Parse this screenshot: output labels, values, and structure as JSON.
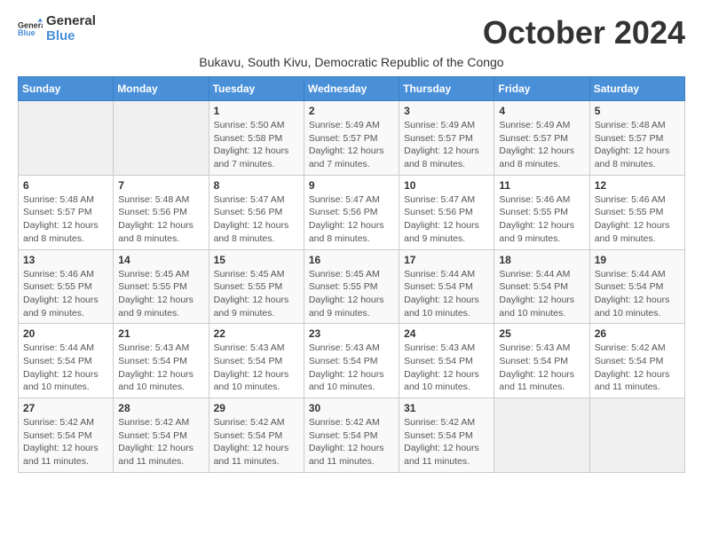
{
  "header": {
    "logo_general": "General",
    "logo_blue": "Blue",
    "month_title": "October 2024",
    "subtitle": "Bukavu, South Kivu, Democratic Republic of the Congo"
  },
  "weekdays": [
    "Sunday",
    "Monday",
    "Tuesday",
    "Wednesday",
    "Thursday",
    "Friday",
    "Saturday"
  ],
  "weeks": [
    [
      {
        "day": "",
        "info": ""
      },
      {
        "day": "",
        "info": ""
      },
      {
        "day": "1",
        "info": "Sunrise: 5:50 AM\nSunset: 5:58 PM\nDaylight: 12 hours and 7 minutes."
      },
      {
        "day": "2",
        "info": "Sunrise: 5:49 AM\nSunset: 5:57 PM\nDaylight: 12 hours and 7 minutes."
      },
      {
        "day": "3",
        "info": "Sunrise: 5:49 AM\nSunset: 5:57 PM\nDaylight: 12 hours and 8 minutes."
      },
      {
        "day": "4",
        "info": "Sunrise: 5:49 AM\nSunset: 5:57 PM\nDaylight: 12 hours and 8 minutes."
      },
      {
        "day": "5",
        "info": "Sunrise: 5:48 AM\nSunset: 5:57 PM\nDaylight: 12 hours and 8 minutes."
      }
    ],
    [
      {
        "day": "6",
        "info": "Sunrise: 5:48 AM\nSunset: 5:57 PM\nDaylight: 12 hours and 8 minutes."
      },
      {
        "day": "7",
        "info": "Sunrise: 5:48 AM\nSunset: 5:56 PM\nDaylight: 12 hours and 8 minutes."
      },
      {
        "day": "8",
        "info": "Sunrise: 5:47 AM\nSunset: 5:56 PM\nDaylight: 12 hours and 8 minutes."
      },
      {
        "day": "9",
        "info": "Sunrise: 5:47 AM\nSunset: 5:56 PM\nDaylight: 12 hours and 8 minutes."
      },
      {
        "day": "10",
        "info": "Sunrise: 5:47 AM\nSunset: 5:56 PM\nDaylight: 12 hours and 9 minutes."
      },
      {
        "day": "11",
        "info": "Sunrise: 5:46 AM\nSunset: 5:55 PM\nDaylight: 12 hours and 9 minutes."
      },
      {
        "day": "12",
        "info": "Sunrise: 5:46 AM\nSunset: 5:55 PM\nDaylight: 12 hours and 9 minutes."
      }
    ],
    [
      {
        "day": "13",
        "info": "Sunrise: 5:46 AM\nSunset: 5:55 PM\nDaylight: 12 hours and 9 minutes."
      },
      {
        "day": "14",
        "info": "Sunrise: 5:45 AM\nSunset: 5:55 PM\nDaylight: 12 hours and 9 minutes."
      },
      {
        "day": "15",
        "info": "Sunrise: 5:45 AM\nSunset: 5:55 PM\nDaylight: 12 hours and 9 minutes."
      },
      {
        "day": "16",
        "info": "Sunrise: 5:45 AM\nSunset: 5:55 PM\nDaylight: 12 hours and 9 minutes."
      },
      {
        "day": "17",
        "info": "Sunrise: 5:44 AM\nSunset: 5:54 PM\nDaylight: 12 hours and 10 minutes."
      },
      {
        "day": "18",
        "info": "Sunrise: 5:44 AM\nSunset: 5:54 PM\nDaylight: 12 hours and 10 minutes."
      },
      {
        "day": "19",
        "info": "Sunrise: 5:44 AM\nSunset: 5:54 PM\nDaylight: 12 hours and 10 minutes."
      }
    ],
    [
      {
        "day": "20",
        "info": "Sunrise: 5:44 AM\nSunset: 5:54 PM\nDaylight: 12 hours and 10 minutes."
      },
      {
        "day": "21",
        "info": "Sunrise: 5:43 AM\nSunset: 5:54 PM\nDaylight: 12 hours and 10 minutes."
      },
      {
        "day": "22",
        "info": "Sunrise: 5:43 AM\nSunset: 5:54 PM\nDaylight: 12 hours and 10 minutes."
      },
      {
        "day": "23",
        "info": "Sunrise: 5:43 AM\nSunset: 5:54 PM\nDaylight: 12 hours and 10 minutes."
      },
      {
        "day": "24",
        "info": "Sunrise: 5:43 AM\nSunset: 5:54 PM\nDaylight: 12 hours and 10 minutes."
      },
      {
        "day": "25",
        "info": "Sunrise: 5:43 AM\nSunset: 5:54 PM\nDaylight: 12 hours and 11 minutes."
      },
      {
        "day": "26",
        "info": "Sunrise: 5:42 AM\nSunset: 5:54 PM\nDaylight: 12 hours and 11 minutes."
      }
    ],
    [
      {
        "day": "27",
        "info": "Sunrise: 5:42 AM\nSunset: 5:54 PM\nDaylight: 12 hours and 11 minutes."
      },
      {
        "day": "28",
        "info": "Sunrise: 5:42 AM\nSunset: 5:54 PM\nDaylight: 12 hours and 11 minutes."
      },
      {
        "day": "29",
        "info": "Sunrise: 5:42 AM\nSunset: 5:54 PM\nDaylight: 12 hours and 11 minutes."
      },
      {
        "day": "30",
        "info": "Sunrise: 5:42 AM\nSunset: 5:54 PM\nDaylight: 12 hours and 11 minutes."
      },
      {
        "day": "31",
        "info": "Sunrise: 5:42 AM\nSunset: 5:54 PM\nDaylight: 12 hours and 11 minutes."
      },
      {
        "day": "",
        "info": ""
      },
      {
        "day": "",
        "info": ""
      }
    ]
  ]
}
